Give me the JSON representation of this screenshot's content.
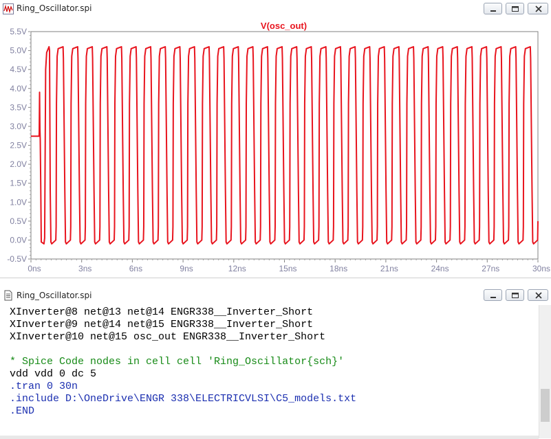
{
  "plot_window": {
    "title": "Ring_Oscillator.spi",
    "trace_label": "V(osc_out)"
  },
  "text_window": {
    "title": "Ring_Oscillator.spi",
    "lines": [
      {
        "text": "XInverter@8 net@13 net@14 ENGR338__Inverter_Short",
        "color": "black"
      },
      {
        "text": "XInverter@9 net@14 net@15 ENGR338__Inverter_Short",
        "color": "black"
      },
      {
        "text": "XInverter@10 net@15 osc_out ENGR338__Inverter_Short",
        "color": "black"
      },
      {
        "text": "",
        "color": "black"
      },
      {
        "text": "* Spice Code nodes in cell cell 'Ring_Oscillator{sch}'",
        "color": "green"
      },
      {
        "text": "vdd vdd 0 dc 5",
        "color": "black"
      },
      {
        "text": ".tran 0 30n",
        "color": "blue"
      },
      {
        "text": ".include D:\\OneDrive\\ENGR 338\\ELECTRICVLSI\\C5_models.txt",
        "color": "blue"
      },
      {
        "text": ".END",
        "color": "blue"
      }
    ]
  },
  "colors": {
    "trace": "#e8141e",
    "axis_text": "#8080a0",
    "tick": "#000080",
    "green_comment": "#168a16",
    "blue_directive": "#1b2fb0"
  },
  "icons": [
    "waveform-icon",
    "minimize-icon",
    "maximize-icon",
    "close-icon",
    "document-icon"
  ],
  "chart_data": {
    "type": "line",
    "title": "V(osc_out)",
    "xlabel": "",
    "ylabel": "",
    "x_unit": "ns",
    "y_unit": "V",
    "xlim": [
      0,
      30
    ],
    "ylim": [
      -0.5,
      5.5
    ],
    "x_ticks": [
      "0ns",
      "3ns",
      "6ns",
      "9ns",
      "12ns",
      "15ns",
      "18ns",
      "21ns",
      "24ns",
      "27ns",
      "30ns"
    ],
    "y_ticks": [
      "-0.5V",
      "0.0V",
      "0.5V",
      "1.0V",
      "1.5V",
      "2.0V",
      "2.5V",
      "3.0V",
      "3.5V",
      "4.0V",
      "4.5V",
      "5.0V",
      "5.5V"
    ],
    "grid": false,
    "series": [
      {
        "name": "V(osc_out)",
        "initial_level": 2.74,
        "initial_until_ns": 0.55,
        "startup_spike": 3.9,
        "oscillation_start_ns": 0.55,
        "period_ns": 0.864,
        "high_level": 5.1,
        "low_level": -0.1,
        "end_value": 0.5
      }
    ]
  }
}
